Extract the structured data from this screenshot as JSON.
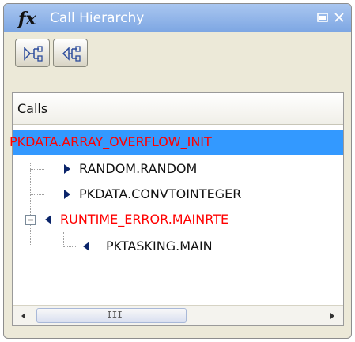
{
  "window": {
    "icon_text": "fx",
    "title": "Call Hierarchy"
  },
  "toolbar": {
    "callees_button_icon": "call-hierarchy-callees-icon",
    "callers_button_icon": "call-hierarchy-callers-icon"
  },
  "column": {
    "header": "Calls"
  },
  "tree": {
    "items": [
      {
        "label": "PKDATA.ARRAY_OVERFLOW_INIT",
        "color": "#ff0000",
        "selected": true
      },
      {
        "label": "RANDOM.RANDOM",
        "color": "#111111",
        "arrow": "right"
      },
      {
        "label": "PKDATA.CONVTOINTEGER",
        "color": "#111111",
        "arrow": "right"
      },
      {
        "label": "RUNTIME_ERROR.MAINRTE",
        "color": "#ff0000",
        "arrow": "left",
        "expanded": true
      },
      {
        "label": "PKTASKING.MAIN",
        "color": "#111111",
        "arrow": "left"
      }
    ]
  },
  "colors": {
    "selection": "#3399ff",
    "error_text": "#ff0000",
    "title_bar": "#a9c6f0",
    "arrow": "#0a246a"
  },
  "scrollbar": {
    "thumb_grip": "III"
  }
}
